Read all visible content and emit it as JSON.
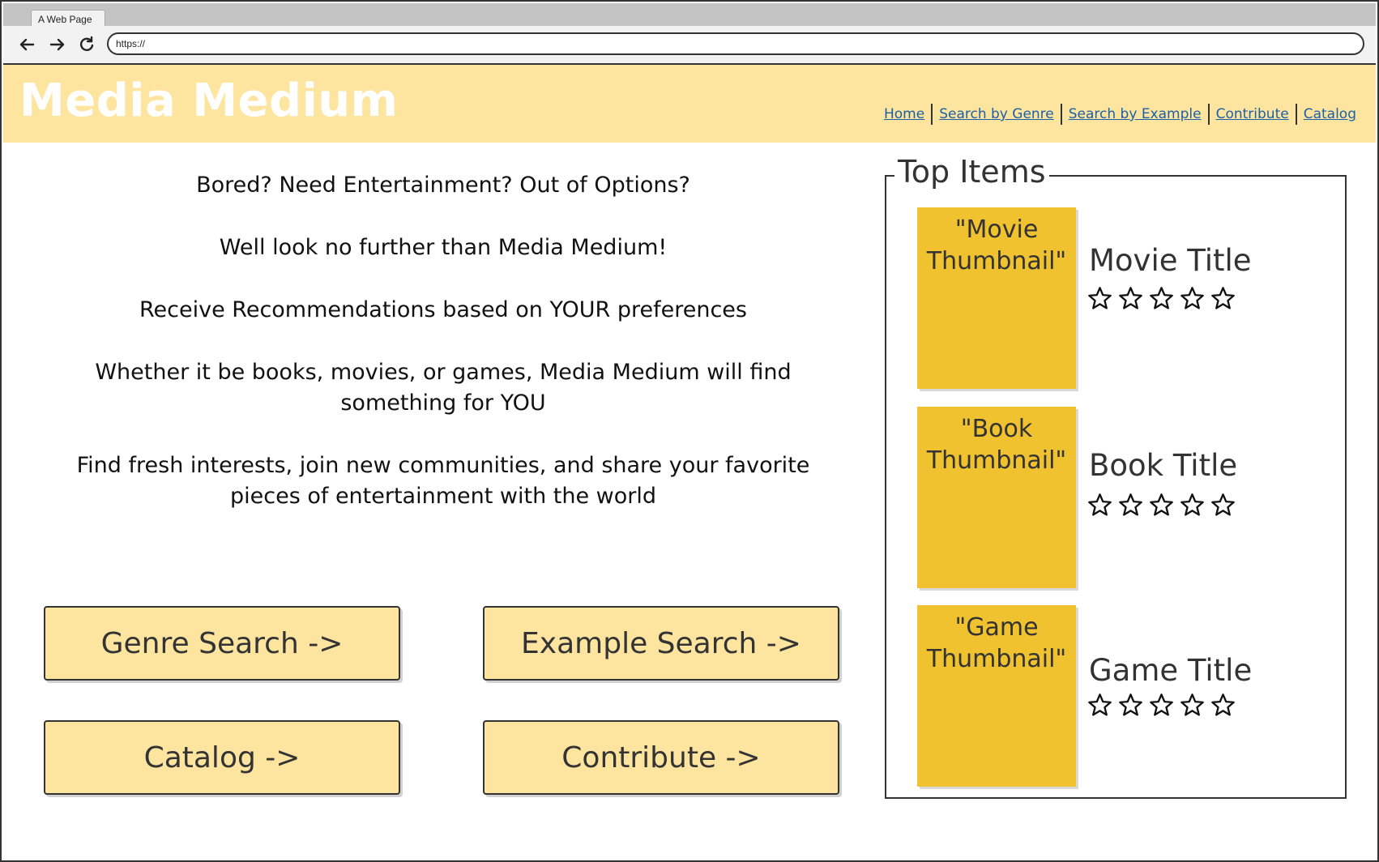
{
  "browser": {
    "tab_title": "A Web Page",
    "url": "https://"
  },
  "header": {
    "title": "Media Medium",
    "nav": [
      "Home",
      "Search by Genre",
      "Search by Example",
      "Contribute",
      "Catalog"
    ]
  },
  "intro": [
    "Bored? Need Entertainment? Out of Options?",
    "Well look no further than Media Medium!",
    "Receive Recommendations based on YOUR preferences",
    "Whether it be books, movies, or games, Media Medium will find something for YOU",
    "Find fresh interests, join new communities, and share your favorite pieces of entertainment with the world"
  ],
  "buttons": {
    "genre": "Genre Search ->",
    "example": "Example Search ->",
    "catalog": "Catalog ->",
    "contribute": "Contribute ->"
  },
  "top_items": {
    "title": "Top Items",
    "items": [
      {
        "thumbnail": "\"Movie Thumbnail\"",
        "title": "Movie Title",
        "rating": 0,
        "max_rating": 5
      },
      {
        "thumbnail": "\"Book Thumbnail\"",
        "title": "Book Title",
        "rating": 0,
        "max_rating": 5
      },
      {
        "thumbnail": "\"Game Thumbnail\"",
        "title": "Game Title",
        "rating": 0,
        "max_rating": 5
      }
    ]
  },
  "colors": {
    "header_bg": "#fee59f",
    "button_bg": "#fee59f",
    "thumbnail_bg": "#f0c22f",
    "link": "#1b5fa8"
  }
}
